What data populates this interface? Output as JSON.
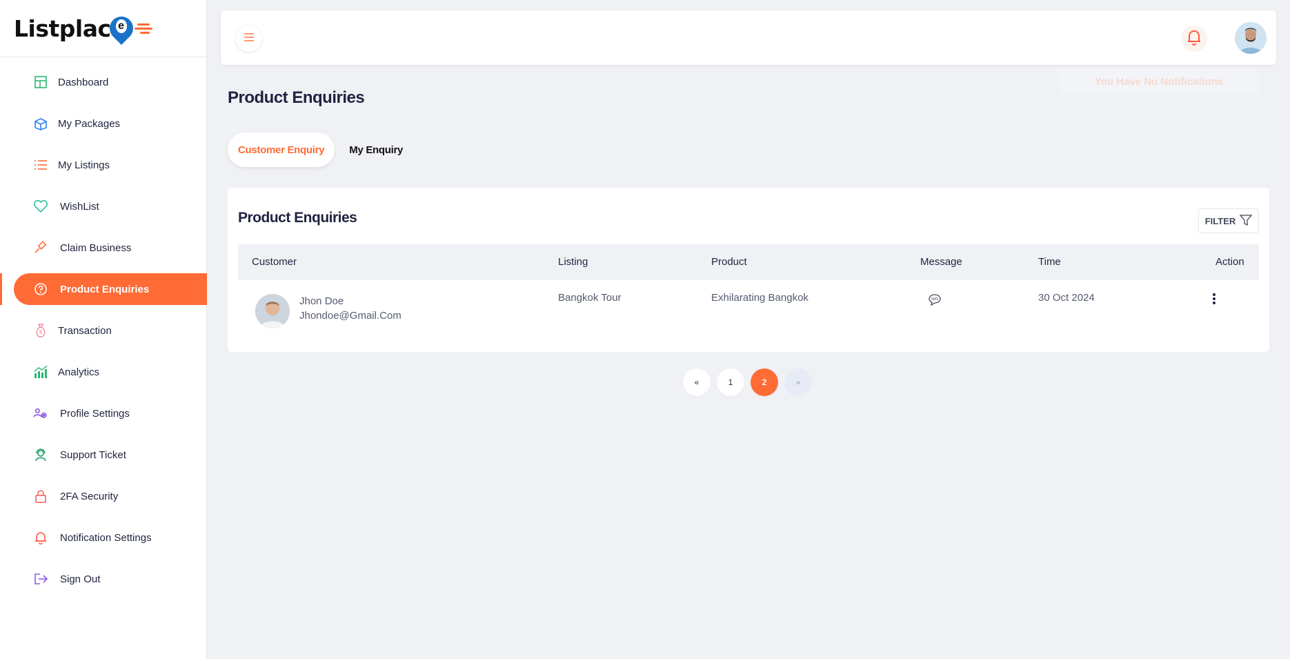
{
  "brand": {
    "logo_text": "Listplac",
    "logo_letter": "e",
    "accent": "#ff6b35"
  },
  "sidebar": {
    "items": [
      {
        "label": "Dashboard",
        "icon": "dashboard-icon"
      },
      {
        "label": "My Packages",
        "icon": "package-icon"
      },
      {
        "label": "My Listings",
        "icon": "list-icon"
      },
      {
        "label": "WishList",
        "icon": "heart-icon"
      },
      {
        "label": "Claim Business",
        "icon": "gavel-icon"
      },
      {
        "label": "Product Enquiries",
        "icon": "question-icon",
        "active": true
      },
      {
        "label": "Transaction",
        "icon": "money-bag-icon"
      },
      {
        "label": "Analytics",
        "icon": "chart-icon"
      },
      {
        "label": "Profile Settings",
        "icon": "profile-gear-icon"
      },
      {
        "label": "Support Ticket",
        "icon": "support-icon"
      },
      {
        "label": "2FA Security",
        "icon": "lock-icon"
      },
      {
        "label": "Notification Settings",
        "icon": "bell-icon"
      },
      {
        "label": "Sign Out",
        "icon": "sign-out-icon"
      }
    ]
  },
  "topbar": {
    "notifications_empty": "You Have No Notifications"
  },
  "page": {
    "title": "Product Enquiries"
  },
  "tabs": {
    "customer": "Customer Enquiry",
    "mine": "My Enquiry"
  },
  "card": {
    "title": "Product Enquiries",
    "filter_label": "FILTER",
    "columns": [
      "Customer",
      "Listing",
      "Product",
      "Message",
      "Time",
      "Action"
    ],
    "rows": [
      {
        "name": "Jhon Doe",
        "email": "Jhondoe@Gmail.Com",
        "listing": "Bangkok Tour",
        "product": "Exhilarating Bangkok",
        "time": "30 Oct 2024"
      }
    ]
  },
  "pagination": {
    "prev": "«",
    "pages": [
      "1",
      "2"
    ],
    "current": "2",
    "next": "»"
  }
}
